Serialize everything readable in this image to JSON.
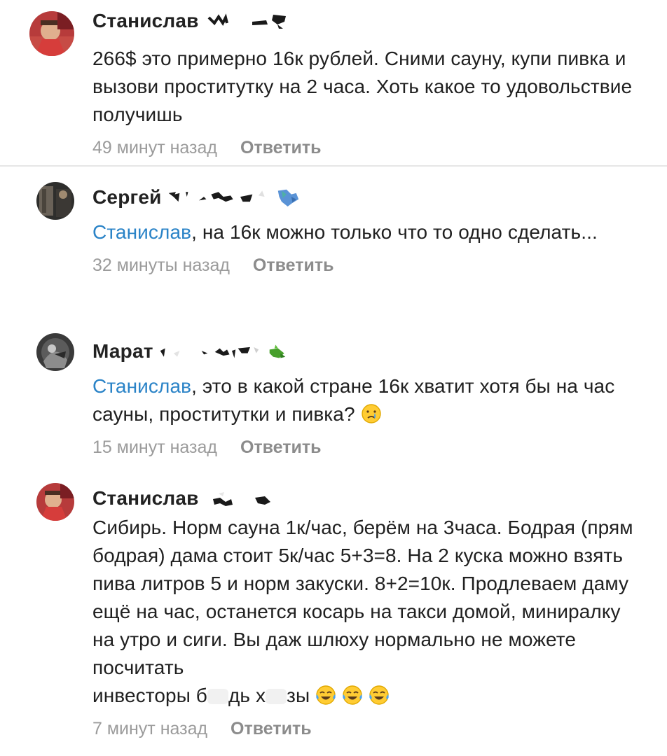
{
  "comments": [
    {
      "author": "Станислав",
      "text": "266$ это примерно 16к рублей. Сними сауну, купи пивка и вызови проститутку на 2 часа. Хоть какое то удовольствие получишь",
      "time": "49 минут назад",
      "reply": "Ответить"
    },
    {
      "author": "Сергей",
      "mention": "Станислав",
      "text": ", на 16к можно только что то одно сделать...",
      "time": "32 минуты назад",
      "reply": "Ответить"
    },
    {
      "author": "Марат",
      "mention": "Станислав",
      "text": ", это в какой стране 16к хватит хотя бы на час сауны, проститутки и пивка?",
      "time": "15 минут назад",
      "reply": "Ответить"
    },
    {
      "author": "Станислав",
      "text_main": "Сибирь. Норм сауна 1к/час, берём на 3часа. Бодрая (прям бодрая) дама стоит 5к/час 5+3=8. На 2 куска можно взять пива литров 5 и норм закуски. 8+2=10к. Продлеваем даму ещё на час, останется косарь на такси домой, миниралку на утро и сиги. Вы даж шлюху нормально не можете посчитать",
      "text_tail_1": "инвесторы б",
      "text_tail_2": "дь х",
      "text_tail_3": "зы",
      "time": "7 минут назад",
      "reply": "Ответить"
    }
  ],
  "icons": {
    "crying_emoji": "crying-face-emoji",
    "laughing_emoji": "tears-of-joy-emoji"
  },
  "colors": {
    "mention": "#2a83c7",
    "meta": "#9b9b9b"
  }
}
